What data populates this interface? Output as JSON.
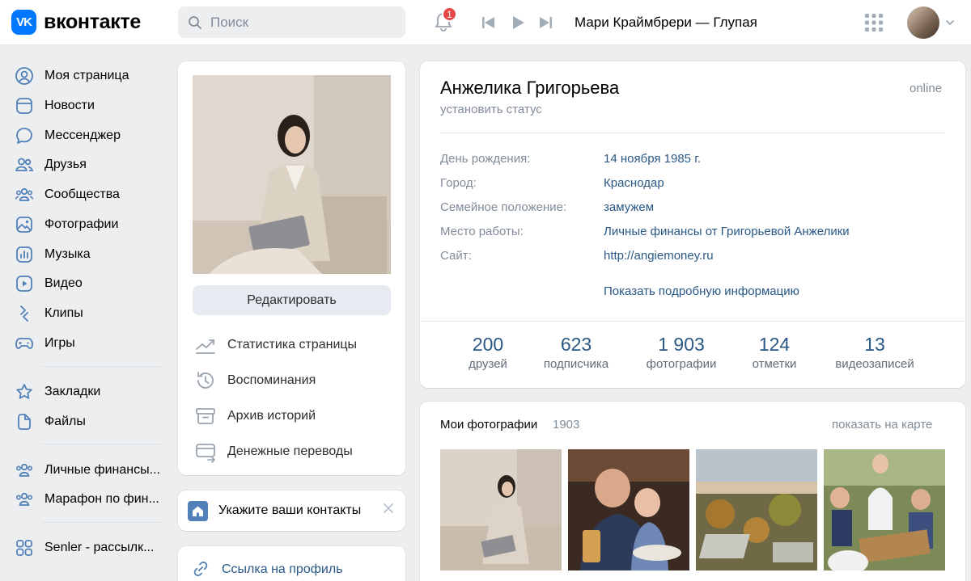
{
  "header": {
    "logo_mark": "VK",
    "logo_text": "вконтакте",
    "search_placeholder": "Поиск",
    "notifications_badge": "1",
    "now_playing": "Мари Краймбрери — Глупая"
  },
  "sidebar": {
    "items": [
      {
        "label": "Моя страница",
        "icon": "user-circle-icon"
      },
      {
        "label": "Новости",
        "icon": "news-icon"
      },
      {
        "label": "Мессенджер",
        "icon": "message-icon"
      },
      {
        "label": "Друзья",
        "icon": "friends-icon"
      },
      {
        "label": "Сообщества",
        "icon": "communities-icon"
      },
      {
        "label": "Фотографии",
        "icon": "photo-icon"
      },
      {
        "label": "Музыка",
        "icon": "music-icon"
      },
      {
        "label": "Видео",
        "icon": "video-icon"
      },
      {
        "label": "Клипы",
        "icon": "clips-icon"
      },
      {
        "label": "Игры",
        "icon": "gamepad-icon"
      },
      {
        "label": "Закладки",
        "icon": "star-icon"
      },
      {
        "label": "Файлы",
        "icon": "file-icon"
      },
      {
        "label": "Личные финансы...",
        "icon": "group-icon"
      },
      {
        "label": "Марафон по фин...",
        "icon": "group-icon"
      },
      {
        "label": "Senler - рассылк...",
        "icon": "apps-icon"
      }
    ]
  },
  "left_column": {
    "edit_button": "Редактировать",
    "actions": [
      {
        "label": "Статистика страницы",
        "icon": "stats-icon"
      },
      {
        "label": "Воспоминания",
        "icon": "history-icon"
      },
      {
        "label": "Архив историй",
        "icon": "archive-icon"
      },
      {
        "label": "Денежные переводы",
        "icon": "money-transfer-icon"
      }
    ],
    "contacts_prompt": "Укажите ваши контакты",
    "profile_link": "Ссылка на профиль"
  },
  "profile": {
    "name": "Анжелика Григорьева",
    "online": "online",
    "set_status": "установить статус",
    "info": [
      {
        "label": "День рождения:",
        "value": "14 ноября 1985 г."
      },
      {
        "label": "Город:",
        "value": "Краснодар"
      },
      {
        "label": "Семейное положение:",
        "value": "замужем"
      },
      {
        "label": "Место работы:",
        "value": "Личные финансы от Григорьевой Анжелики"
      },
      {
        "label": "Сайт:",
        "value": "http://angiemoney.ru"
      }
    ],
    "show_more": "Показать подробную информацию",
    "stats": [
      {
        "num": "200",
        "cap": "друзей"
      },
      {
        "num": "623",
        "cap": "подписчика"
      },
      {
        "num": "1 903",
        "cap": "фотографии"
      },
      {
        "num": "124",
        "cap": "отметки"
      },
      {
        "num": "13",
        "cap": "видеозаписей"
      }
    ]
  },
  "photos": {
    "title": "Мои фотографии",
    "count": "1903",
    "map_link": "показать на карте"
  },
  "colors": {
    "brand": "#0077ff",
    "link": "#2a5885",
    "muted": "#818c99",
    "badge": "#e64646",
    "background": "#edeef0"
  }
}
